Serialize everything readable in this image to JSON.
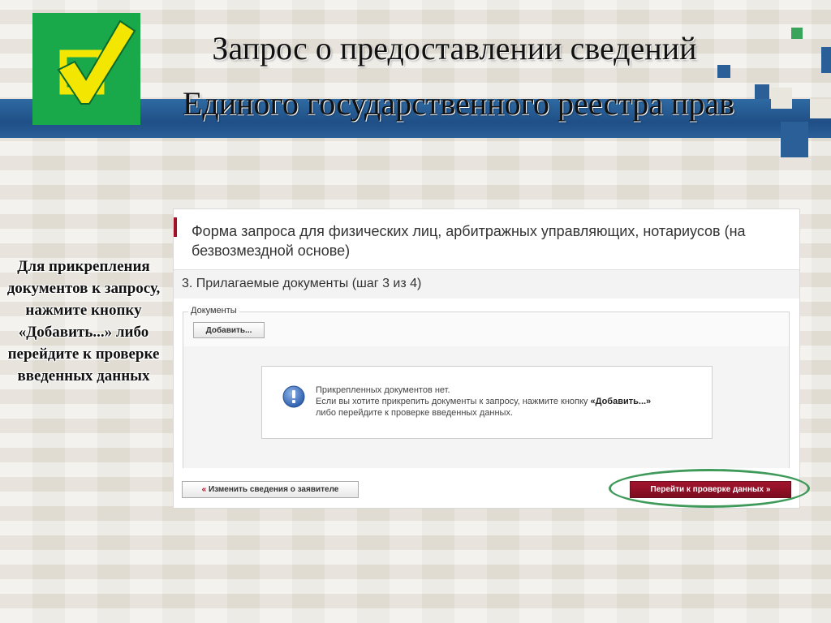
{
  "slide": {
    "title_line1": "Запрос о предоставлении сведений",
    "title_line2": "Единого государственного реестра прав",
    "side_note": "Для прикрепления документов к запросу, нажмите кнопку «Добавить...» либо перейдите к проверке введенных данных"
  },
  "form": {
    "title": "Форма запроса для физических лиц, арбитражных управляющих, нотариусов (на безвозмездной основе)",
    "step_label": "3. Прилагаемые документы (шаг 3 из 4)",
    "documents_legend": "Документы",
    "add_button": "Добавить...",
    "info": {
      "line1": "Прикрепленных документов нет.",
      "line2_prefix": "Если вы хотите прикрепить документы к запросу, нажмите кнопку ",
      "line2_button": "«Добавить...»",
      "line3": "либо перейдите к проверке введенных данных."
    },
    "back_button_mark": "«",
    "back_button": "Изменить сведения о заявителе",
    "next_button": "Перейти к проверке данных »"
  },
  "colors": {
    "accent": "#a3102a",
    "logo_green": "#19a84a",
    "check_yellow": "#f3e600",
    "band_blue": "#1f4f86",
    "highlight_green": "#3f9a5a"
  },
  "icons": [
    "checkmark-logo-icon",
    "info-icon"
  ]
}
